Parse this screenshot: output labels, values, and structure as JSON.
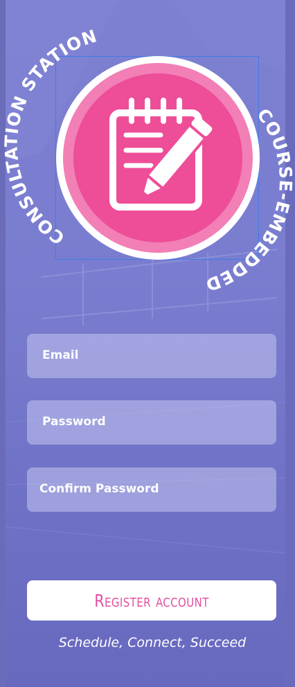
{
  "logo": {
    "arc_top": "CONSULTATION STATION",
    "arc_right": "COURSE-EMBEDDED",
    "icon": "notepad-pencil-icon",
    "colors": {
      "outer": "#ffffff",
      "ring": "#f27fb6",
      "core": "#ee4d98"
    }
  },
  "form": {
    "email_label": "Email",
    "password_label": "Password",
    "confirm_password_label": "Confirm Password"
  },
  "register_button": {
    "label": "Register account",
    "text_color": "#e34fa0"
  },
  "tagline": "Schedule, Connect, Succeed",
  "colors": {
    "background": "#7476c9",
    "field_fill": "#c4c6f0",
    "button_fill": "#ffffff"
  }
}
